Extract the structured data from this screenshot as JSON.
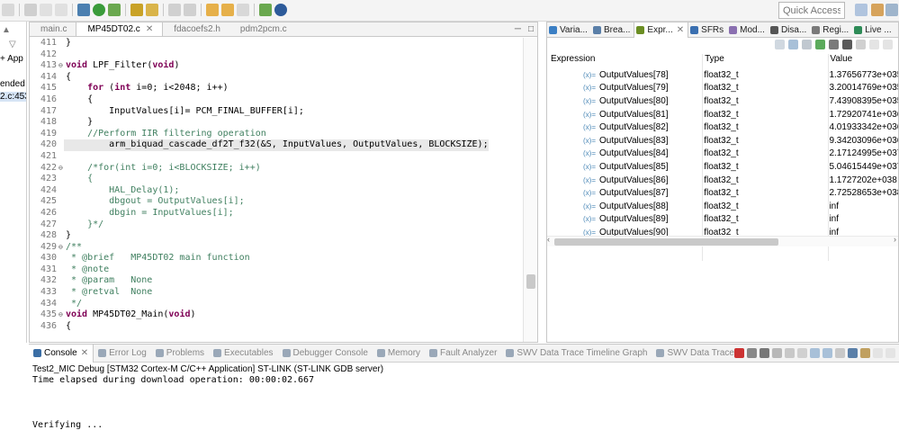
{
  "toolbar": {
    "quick_access_placeholder": "Quick Access",
    "icons": [
      "debug-icon",
      "run-icon",
      "external-tools-icon",
      "new-icon",
      "save-icon",
      "build-icon",
      "search-icon",
      "back-icon",
      "forward-icon",
      "perspective-icon",
      "info-icon"
    ]
  },
  "left_panel": {
    "fragments": [
      "▲",
      "▽",
      "+ App",
      "ended",
      "2.c:453"
    ]
  },
  "editor": {
    "tabs": [
      {
        "label": "main.c",
        "active": false
      },
      {
        "label": "MP45DT02.c",
        "active": true
      },
      {
        "label": "fdacoefs2.h",
        "active": false
      },
      {
        "label": "pdm2pcm.c",
        "active": false
      }
    ],
    "close_glyph": "✕",
    "lines": [
      {
        "num": "411",
        "fold": "",
        "text": "}"
      },
      {
        "num": "412",
        "fold": "",
        "text": ""
      },
      {
        "num": "413",
        "fold": "⊖",
        "text": "void LPF_Filter(void)"
      },
      {
        "num": "414",
        "fold": "",
        "text": "{"
      },
      {
        "num": "415",
        "fold": "",
        "text": "    for (int i=0; i<2048; i++)"
      },
      {
        "num": "416",
        "fold": "",
        "text": "    {"
      },
      {
        "num": "417",
        "fold": "",
        "text": "        InputValues[i]= PCM_FINAL_BUFFER[i];"
      },
      {
        "num": "418",
        "fold": "",
        "text": "    }"
      },
      {
        "num": "419",
        "fold": "",
        "text": "    //Perform IIR filtering operation"
      },
      {
        "num": "420",
        "fold": "",
        "text": "        arm_biquad_cascade_df2T_f32(&S, InputValues, OutputValues, BLOCKSIZE);"
      },
      {
        "num": "421",
        "fold": "",
        "text": ""
      },
      {
        "num": "422",
        "fold": "⊖",
        "text": "    /*for(int i=0; i<BLOCKSIZE; i++)"
      },
      {
        "num": "423",
        "fold": "",
        "text": "    {"
      },
      {
        "num": "424",
        "fold": "",
        "text": "        HAL_Delay(1);"
      },
      {
        "num": "425",
        "fold": "",
        "text": "        dbgout = OutputValues[i];"
      },
      {
        "num": "426",
        "fold": "",
        "text": "        dbgin = InputValues[i];"
      },
      {
        "num": "427",
        "fold": "",
        "text": "    }*/"
      },
      {
        "num": "428",
        "fold": "",
        "text": "}"
      },
      {
        "num": "429",
        "fold": "⊖",
        "text": "/**"
      },
      {
        "num": "430",
        "fold": "",
        "text": " * @brief   MP45DT02 main function"
      },
      {
        "num": "431",
        "fold": "",
        "text": " * @note"
      },
      {
        "num": "432",
        "fold": "",
        "text": " * @param   None"
      },
      {
        "num": "433",
        "fold": "",
        "text": " * @retval  None"
      },
      {
        "num": "434",
        "fold": "",
        "text": " */"
      },
      {
        "num": "435",
        "fold": "⊖",
        "text": "void MP45DT02_Main(void)"
      },
      {
        "num": "436",
        "fold": "",
        "text": "{"
      }
    ]
  },
  "right_panel": {
    "tabs": [
      {
        "label": "Varia...",
        "active": false,
        "icon": "variables-icon",
        "color": "#3b7fc4"
      },
      {
        "label": "Brea...",
        "active": false,
        "icon": "breakpoints-icon",
        "color": "#5a7fa8"
      },
      {
        "label": "Expr...",
        "active": true,
        "icon": "expressions-icon",
        "color": "#6b8e23"
      },
      {
        "label": "SFRs",
        "active": false,
        "icon": "sfrs-icon",
        "color": "#3a6fb0"
      },
      {
        "label": "Mod...",
        "active": false,
        "icon": "modules-icon",
        "color": "#8a6fb0"
      },
      {
        "label": "Disa...",
        "active": false,
        "icon": "disassembly-icon",
        "color": "#555555"
      },
      {
        "label": "Regi...",
        "active": false,
        "icon": "registers-icon",
        "color": "#7a7a7a"
      },
      {
        "label": "Live ...",
        "active": false,
        "icon": "live-icon",
        "color": "#2e8b57"
      }
    ],
    "columns": [
      "Expression",
      "Type",
      "Value"
    ],
    "rows": [
      {
        "expr": "OutputValues[78]",
        "type": "float32_t",
        "value": "1.37656773e+035"
      },
      {
        "expr": "OutputValues[79]",
        "type": "float32_t",
        "value": "3.20014769e+035"
      },
      {
        "expr": "OutputValues[80]",
        "type": "float32_t",
        "value": "7.43908395e+035"
      },
      {
        "expr": "OutputValues[81]",
        "type": "float32_t",
        "value": "1.72920741e+036"
      },
      {
        "expr": "OutputValues[82]",
        "type": "float32_t",
        "value": "4.01933342e+036"
      },
      {
        "expr": "OutputValues[83]",
        "type": "float32_t",
        "value": "9.34203096e+036"
      },
      {
        "expr": "OutputValues[84]",
        "type": "float32_t",
        "value": "2.17124995e+037"
      },
      {
        "expr": "OutputValues[85]",
        "type": "float32_t",
        "value": "5.04615449e+037"
      },
      {
        "expr": "OutputValues[86]",
        "type": "float32_t",
        "value": "1.1727202e+038"
      },
      {
        "expr": "OutputValues[87]",
        "type": "float32_t",
        "value": "2.72528653e+038"
      },
      {
        "expr": "OutputValues[88]",
        "type": "float32_t",
        "value": "inf"
      },
      {
        "expr": "OutputValues[89]",
        "type": "float32_t",
        "value": "inf"
      },
      {
        "expr": "OutputValues[90]",
        "type": "float32_t",
        "value": "inf"
      }
    ],
    "row_icon": "(x)="
  },
  "console": {
    "tabs": [
      {
        "label": "Console",
        "active": true
      },
      {
        "label": "Error Log",
        "active": false
      },
      {
        "label": "Problems",
        "active": false
      },
      {
        "label": "Executables",
        "active": false
      },
      {
        "label": "Debugger Console",
        "active": false
      },
      {
        "label": "Memory",
        "active": false
      },
      {
        "label": "Fault Analyzer",
        "active": false
      },
      {
        "label": "SWV Data Trace Timeline Graph",
        "active": false
      },
      {
        "label": "SWV Data Trace",
        "active": false
      }
    ],
    "title": "Test2_MIC Debug [STM32 Cortex-M C/C++ Application] ST-LINK (ST-LINK GDB server)",
    "output": [
      "Time elapsed during download operation: 00:00:02.667",
      "",
      "",
      "",
      "Verifying ..."
    ]
  },
  "colors": {
    "keyword": "#7f0055",
    "comment": "#3f7f5f",
    "accent": "#3b7fc4"
  }
}
